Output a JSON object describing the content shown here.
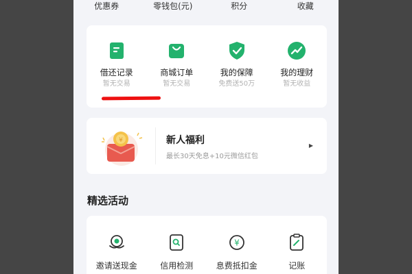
{
  "top_row": [
    "优惠券",
    "零钱包(元)",
    "积分",
    "收藏"
  ],
  "services": [
    {
      "title": "借还记录",
      "sub": "暂无交易",
      "icon": "record-icon"
    },
    {
      "title": "商城订单",
      "sub": "暂无交易",
      "icon": "shopping-bag-icon"
    },
    {
      "title": "我的保障",
      "sub": "免费送50万",
      "icon": "shield-check-icon"
    },
    {
      "title": "我的理财",
      "sub": "暂无收益",
      "icon": "trend-chart-icon"
    }
  ],
  "banner": {
    "title": "新人福利",
    "subtitle": "最长30天免息+10元微信红包",
    "icon": "red-envelope-coin-icon"
  },
  "activities": {
    "title": "精选活动",
    "items": [
      {
        "label": "邀请送现金",
        "icon": "invite-cash-icon"
      },
      {
        "label": "信用检测",
        "icon": "credit-check-icon"
      },
      {
        "label": "息费抵扣金",
        "icon": "yen-coin-icon"
      },
      {
        "label": "记账",
        "icon": "notebook-icon"
      }
    ]
  },
  "colors": {
    "accent_green": "#23b26d",
    "annotation_red": "#ee1111",
    "background": "#f3f4f8"
  }
}
